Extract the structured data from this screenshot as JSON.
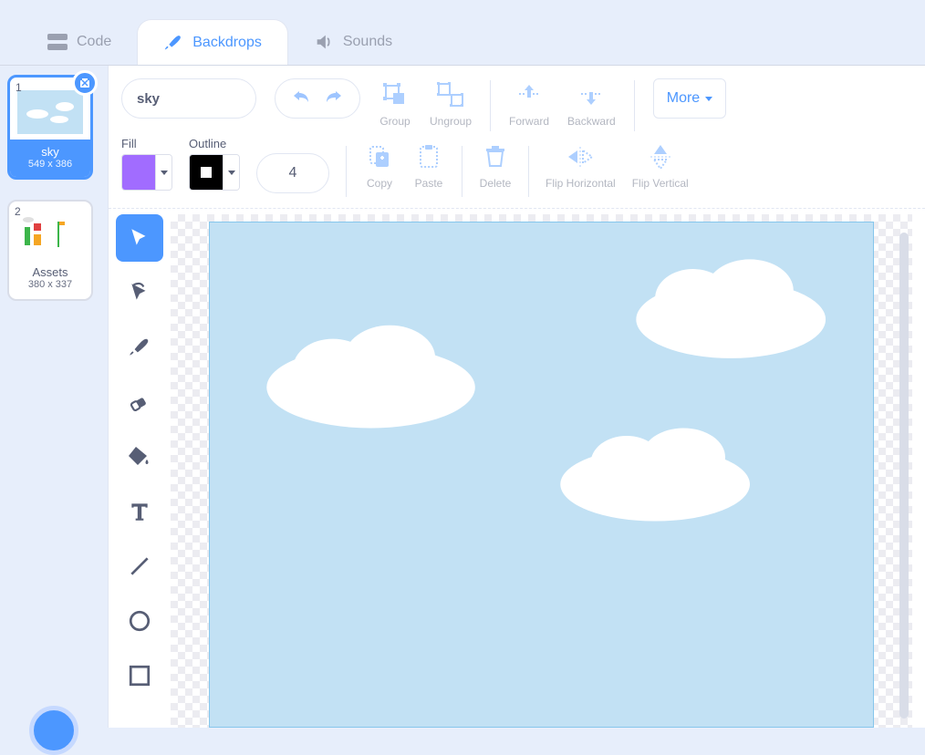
{
  "tabs": {
    "code": {
      "label": "Code"
    },
    "backdrops": {
      "label": "Backdrops"
    },
    "sounds": {
      "label": "Sounds"
    }
  },
  "costumes": [
    {
      "index": "1",
      "name": "sky",
      "dims": "549 x 386",
      "active": true
    },
    {
      "index": "2",
      "name": "Assets",
      "dims": "380 x 337",
      "active": false
    }
  ],
  "toolbar": {
    "name_value": "sky",
    "group": "Group",
    "ungroup": "Ungroup",
    "forward": "Forward",
    "backward": "Backward",
    "more": "More",
    "fill_label": "Fill",
    "outline_label": "Outline",
    "outline_width": "4",
    "copy": "Copy",
    "paste": "Paste",
    "delete": "Delete",
    "flip_h": "Flip Horizontal",
    "flip_v": "Flip Vertical"
  },
  "colors": {
    "fill": "#a16cff",
    "accent": "#4C97FF"
  },
  "tools": [
    "select",
    "reshape",
    "brush",
    "eraser",
    "fill",
    "text",
    "line",
    "circle",
    "rect"
  ]
}
